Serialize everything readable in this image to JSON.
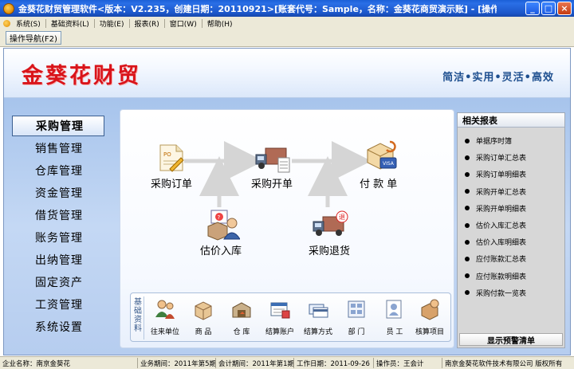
{
  "window": {
    "title": "金葵花财贸管理软件<版本：V2.235，创建日期：20110921>[账套代号：Sample，名称：金葵花商贸演示账] - [操作导航]",
    "min": "_",
    "max": "□",
    "close": "×"
  },
  "menu": [
    {
      "label": "系统(S)"
    },
    {
      "label": "基础资料(L)"
    },
    {
      "label": "功能(E)"
    },
    {
      "label": "报表(R)"
    },
    {
      "label": "窗口(W)"
    },
    {
      "label": "帮助(H)"
    }
  ],
  "tab": {
    "label": "操作导航(F2)"
  },
  "banner": {
    "brand": "金葵花财贸",
    "slogan": "简洁•实用•灵活•高效"
  },
  "nav": [
    {
      "label": "采购管理",
      "active": true
    },
    {
      "label": "销售管理"
    },
    {
      "label": "仓库管理"
    },
    {
      "label": "资金管理"
    },
    {
      "label": "借货管理"
    },
    {
      "label": "账务管理"
    },
    {
      "label": "出纳管理"
    },
    {
      "label": "固定资产"
    },
    {
      "label": "工资管理"
    },
    {
      "label": "系统设置"
    }
  ],
  "flow": {
    "order": "采购订单",
    "bill": "采购开单",
    "pay": "付 款 单",
    "estimate": "估价入库",
    "return": "采购退货"
  },
  "base": {
    "title": "基础资料",
    "items": [
      {
        "label": "往来单位"
      },
      {
        "label": "商  品"
      },
      {
        "label": "仓  库"
      },
      {
        "label": "结算账户"
      },
      {
        "label": "结算方式"
      },
      {
        "label": "部  门"
      },
      {
        "label": "员  工"
      },
      {
        "label": "核算项目"
      }
    ]
  },
  "reports": {
    "title": "相关报表",
    "items": [
      {
        "label": "单据序时簿"
      },
      {
        "label": "采购订单汇总表"
      },
      {
        "label": "采购订单明细表"
      },
      {
        "label": "采购开单汇总表"
      },
      {
        "label": "采购开单明细表"
      },
      {
        "label": "估价入库汇总表"
      },
      {
        "label": "估价入库明细表"
      },
      {
        "label": "应付账款汇总表"
      },
      {
        "label": "应付账款明细表"
      },
      {
        "label": "采购付款一览表"
      }
    ],
    "footer": "显示预警清单"
  },
  "status": {
    "company": "企业名称：南京金葵花",
    "period": "业务期间：2011年第5期",
    "account_period": "会计期间：2011年第1期",
    "work_date": "工作日期：2011-09-26",
    "operator": "操作员：王会计",
    "copyright": "南京金葵花软件技术有限公司 版权所有"
  },
  "colors": {
    "brand": "#d9141a",
    "slogan": "#1e4f8f",
    "titlebar": "#1b55c8"
  }
}
